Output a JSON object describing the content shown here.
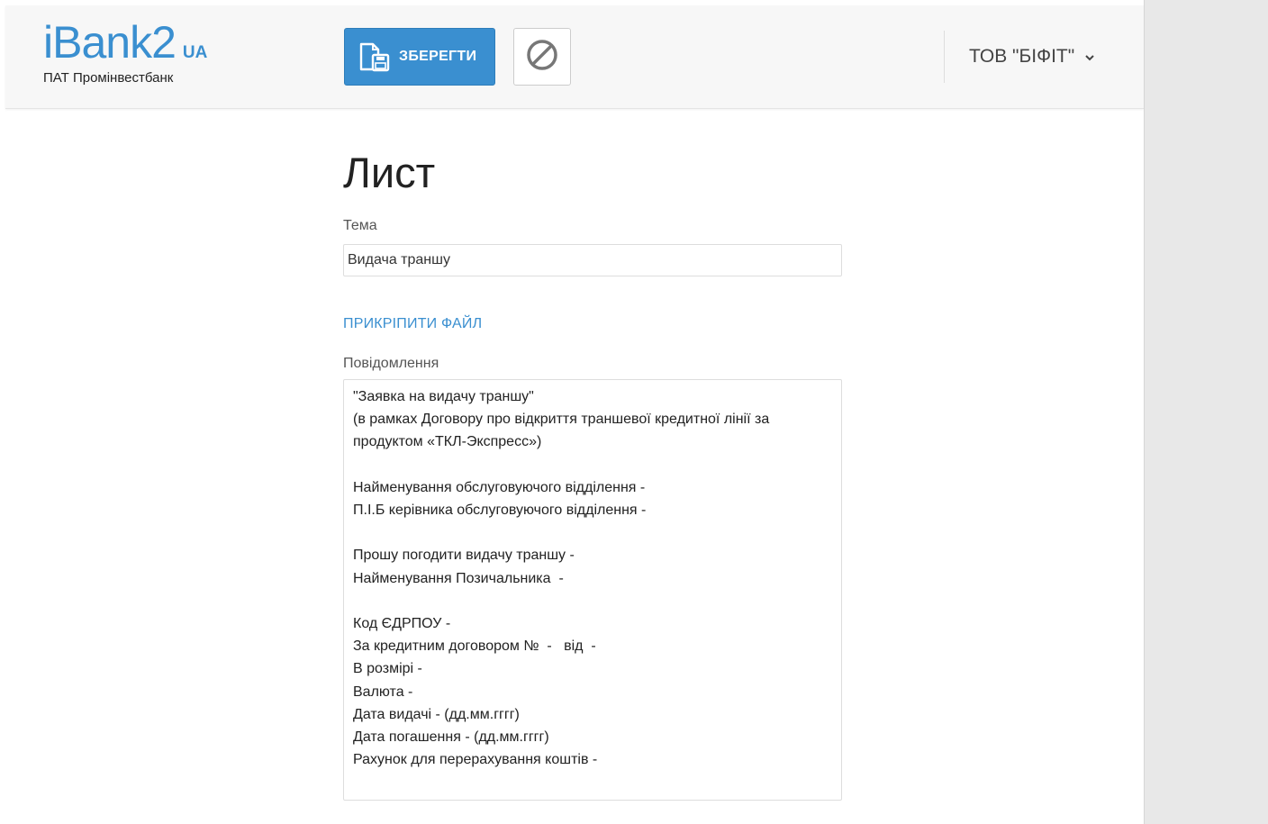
{
  "brand": {
    "name": "iBank2",
    "country": "UA",
    "bank": "ПАТ Промінвестбанк"
  },
  "toolbar": {
    "save_label": "ЗБЕРЕГТИ",
    "save_icon": "save-icon",
    "cancel_icon": "cancel-icon"
  },
  "user_menu": {
    "company": "ТОВ \"БІФІТ\""
  },
  "form": {
    "title": "Лист",
    "subject_label": "Тема",
    "subject_value": "Видача траншу",
    "attach_link": "ПРИКРІПИТИ ФАЙЛ",
    "message_label": "Повідомлення",
    "message_value": "\"Заявка на видачу траншу\"\n(в рамках Договору про відкриття траншевої кредитної лінії за продуктом «ТКЛ-Экспресс»)\n\nНайменування обслуговуючого відділення -\nП.І.Б керівника обслуговуючого відділення -\n\nПрошу погодити видачу траншу -\nНайменування Позичальника  -\n\nКод ЄДРПОУ -\nЗа кредитним договором №  -   від  -\nВ розмірі -\nВалюта -\nДата видачі - (дд.мм.гггг)\nДата погашення - (дд.мм.гггг)\nРахунок для перерахування коштів -"
  },
  "colors": {
    "accent": "#3a8fd0",
    "header_bg": "#f7f7f7",
    "gutter_bg": "#e8e8e8"
  }
}
